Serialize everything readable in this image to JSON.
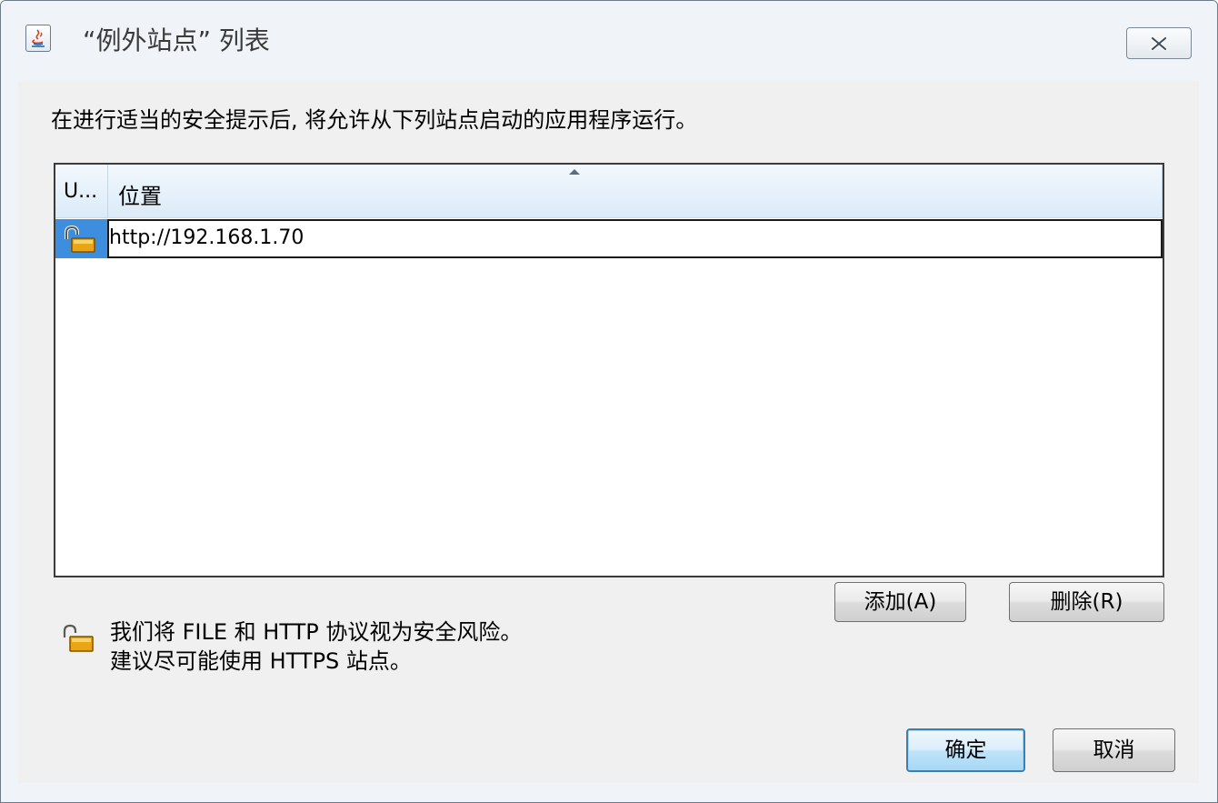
{
  "window": {
    "title": "“例外站点” 列表",
    "app_icon": "java-icon",
    "close_icon": "close-icon"
  },
  "instruction": "在进行适当的安全提示后, 将允许从下列站点启动的应用程序运行。",
  "table": {
    "columns": [
      "U...",
      "位置"
    ],
    "sorted_column": "位置",
    "sort_direction": "ascending",
    "rows": [
      {
        "icon": "unlocked-padlock-icon",
        "location": "http://192.168.1.70",
        "selected": true
      }
    ]
  },
  "actions": {
    "add_label": "添加(A)",
    "remove_label": "删除(R)"
  },
  "warning": {
    "icon": "unlocked-padlock-icon",
    "line1": "我们将 FILE 和 HTTP 协议视为安全风险。",
    "line2": "建议尽可能使用 HTTPS 站点。"
  },
  "footer": {
    "ok_label": "确定",
    "cancel_label": "取消"
  },
  "colors": {
    "selection_blue": "#3e8ee0",
    "default_button_border": "#3c7fb1"
  }
}
